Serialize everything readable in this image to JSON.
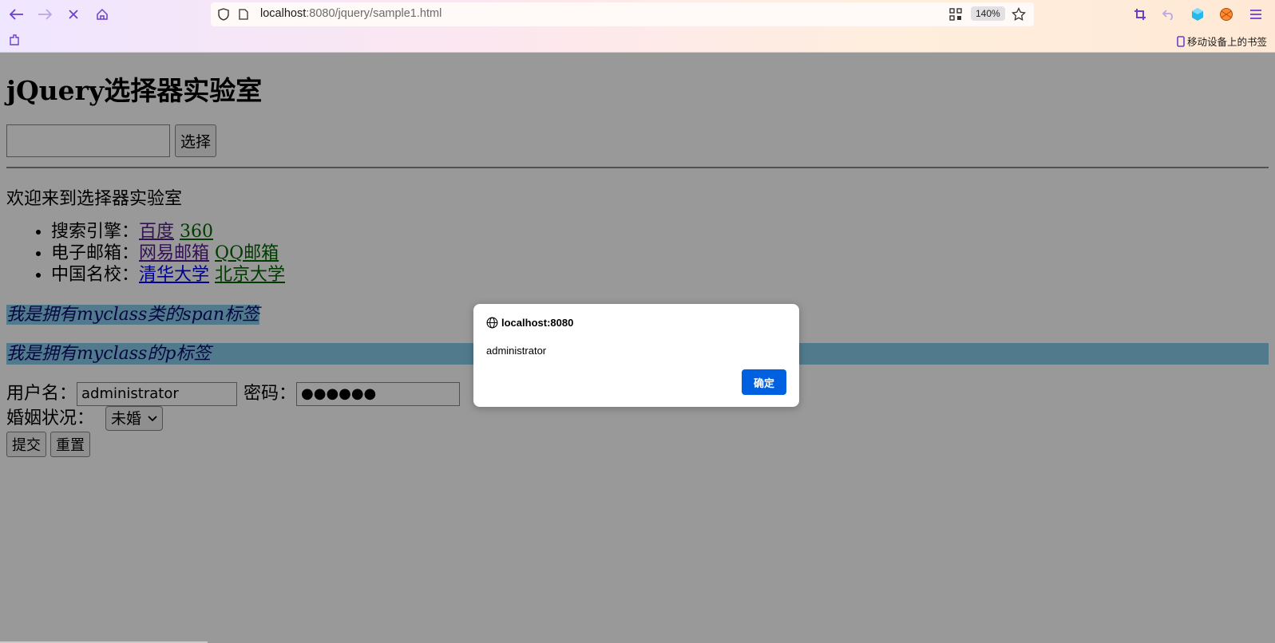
{
  "browser": {
    "url_host": "localhost",
    "url_rest": ":8080/jquery/sample1.html",
    "zoom": "140%",
    "bookmarks_label": "移动设备上的书签"
  },
  "page": {
    "title": "jQuery选择器实验室",
    "search_button": "选择",
    "welcome": "欢迎来到选择器实验室",
    "list": [
      {
        "label": "搜索引擎：",
        "links": [
          "百度",
          "360"
        ]
      },
      {
        "label": "电子邮箱：",
        "links": [
          "网易邮箱",
          "QQ邮箱"
        ]
      },
      {
        "label": "中国名校：",
        "links": [
          "清华大学",
          "北京大学"
        ]
      }
    ],
    "span_text": "我是拥有myclass类的span标签",
    "p_text": "我是拥有myclass的p标签",
    "form": {
      "username_label": "用户名：",
      "username_value": "administrator",
      "password_label": "密码：",
      "password_value": "●●●●●●",
      "marital_label": "婚姻状况：",
      "marital_value": "未婚",
      "submit": "提交",
      "reset": "重置"
    }
  },
  "dialog": {
    "origin": "localhost:8080",
    "message": "administrator",
    "ok": "确定"
  }
}
